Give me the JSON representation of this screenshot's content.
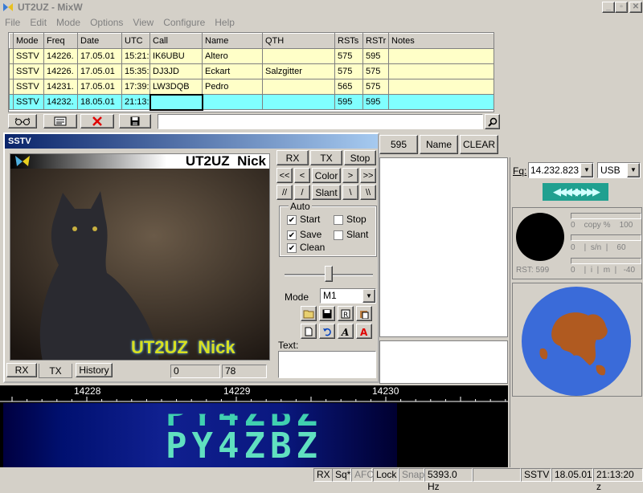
{
  "window": {
    "title": "UT2UZ - MixW",
    "min": "_",
    "max": "▫",
    "close": "✕"
  },
  "menu": [
    "File",
    "Edit",
    "Mode",
    "Options",
    "View",
    "Configure",
    "Help"
  ],
  "log": {
    "headers": [
      "Mode",
      "Freq",
      "Date",
      "UTC",
      "Call",
      "Name",
      "QTH",
      "RSTs",
      "RSTr",
      "Notes"
    ],
    "rows": [
      [
        "SSTV",
        "14226.",
        "17.05.01",
        "15:21:",
        "IK6UBU",
        "Altero",
        "",
        "575",
        "595",
        ""
      ],
      [
        "SSTV",
        "14226.",
        "17.05.01",
        "15:35:",
        "DJ3JD",
        "Eckart",
        "Salzgitter",
        "575",
        "575",
        ""
      ],
      [
        "SSTV",
        "14231.",
        "17.05.01",
        "17:39:",
        "LW3DQB",
        "Pedro",
        "",
        "565",
        "575",
        ""
      ],
      [
        "SSTV",
        "14232.",
        "18.05.01",
        "21:13:",
        "",
        "",
        "",
        "595",
        "595",
        ""
      ]
    ]
  },
  "toolbar": {
    "rst_value": "595",
    "name_button": "Name",
    "clear_button": "CLEAR"
  },
  "sstv": {
    "title": "SSTV",
    "header_text": "UT2UZ  Nick",
    "overlay_text": "UT2UZ  Nick",
    "buttons": {
      "rx": "RX",
      "tx": "TX",
      "stop": "Stop",
      "color": "Color",
      "slant": "Slant",
      "prev2": "<<",
      "prev": "<",
      "next": ">",
      "next2": ">>",
      "sl1": "//",
      "sl2": "/",
      "sl3": "\\",
      "sl4": "\\\\"
    },
    "auto_label": "Auto",
    "checks": {
      "start": "Start",
      "stop": "Stop",
      "save": "Save",
      "slant": "Slant",
      "clean": "Clean"
    },
    "mode_label": "Mode",
    "mode_value": "M1",
    "text_label": "Text:",
    "tabs": {
      "rx": "RX",
      "tx": "TX",
      "history": "History"
    },
    "counter1": "0",
    "counter2": "78"
  },
  "right": {
    "fq_label": "Fq:",
    "fq_value": "14.232.823",
    "sideband": "USB",
    "copy_label": "0    copy %    100",
    "sn_label": "0    |  s/n  |    60",
    "rst_label": "RST: 599",
    "imd_label": "0    |  i  |  m  |   -40"
  },
  "waterfall": {
    "ticks": [
      "14228",
      "14229",
      "14230"
    ],
    "callsign": "PY4ZBZ"
  },
  "status": {
    "rx": "RX",
    "sq": "Sq*",
    "afc": "AFC",
    "lock": "Lock",
    "snap": "Snap",
    "hz": "5393.0 Hz",
    "mode": "SSTV",
    "date": "18.05.01",
    "time": "21:13:20 z"
  },
  "colors": {
    "log_yellow": "#ffffc8",
    "log_cyan": "#80ffff",
    "globe_ocean": "#3a6bd9",
    "globe_land": "#b05a20"
  }
}
